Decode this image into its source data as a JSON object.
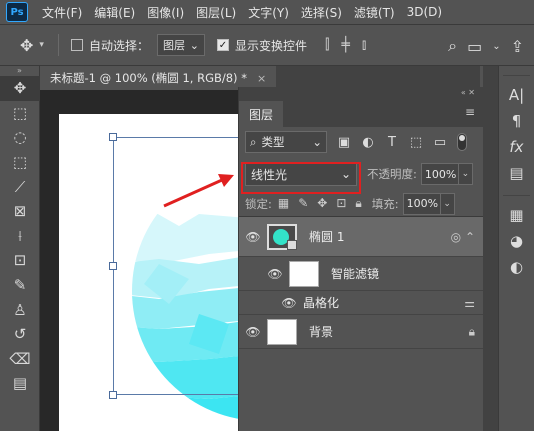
{
  "menubar": {
    "logo": "Ps",
    "items": [
      "文件(F)",
      "编辑(E)",
      "图像(I)",
      "图层(L)",
      "文字(Y)",
      "选择(S)",
      "滤镜(T)",
      "3D(D)"
    ]
  },
  "options": {
    "auto_select_label": "自动选择：",
    "auto_select_value": "图层",
    "show_transform_label": "显示变换控件"
  },
  "document_tab": {
    "title": "未标题-1 @ 100% (椭圆 1, RGB/8) *",
    "close": "×"
  },
  "layers_panel": {
    "tab_label": "图层",
    "filter_label": "类型",
    "blend_mode": "线性光",
    "opacity_label": "不透明度:",
    "opacity_value": "100%",
    "lock_label": "锁定:",
    "fill_label": "填充:",
    "fill_value": "100%",
    "layers": [
      {
        "name": "椭圆 1",
        "selected": true,
        "visible": true
      },
      {
        "name": "智能滤镜",
        "visible": true
      },
      {
        "name": "晶格化",
        "visible": true
      },
      {
        "name": "背景",
        "visible": true,
        "locked": true
      }
    ]
  },
  "colors": {
    "highlight": "#e02020",
    "arrow": "#e02020",
    "ellipse": "#2ee6f2",
    "background": "#535353"
  }
}
